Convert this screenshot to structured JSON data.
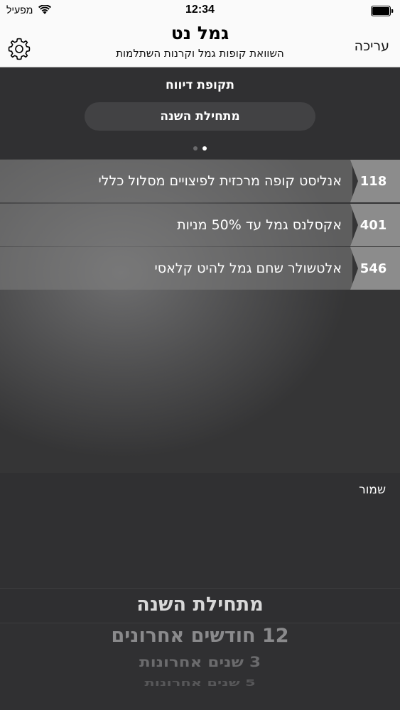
{
  "status_bar": {
    "carrier": "מפעיל",
    "time": "12:34"
  },
  "nav": {
    "title": "גמל נט",
    "subtitle": "השוואת קופות גמל וקרנות השתלמות",
    "edit_label": "עריכה"
  },
  "report": {
    "period_label": "תקופת דיווח",
    "period_value": "מתחילת השנה",
    "page_count": 2,
    "current_page": 1
  },
  "funds": [
    {
      "rank": "118",
      "name": "אנליסט קופה מרכזית לפיצויים מסלול כללי"
    },
    {
      "rank": "401",
      "name": "אקסלנס גמל עד 50% מניות"
    },
    {
      "rank": "546",
      "name": "אלטשולר שחם גמל להיט קלאסי"
    }
  ],
  "toolbar": {
    "save_label": "שמור"
  },
  "picker": {
    "selected": "מתחילת השנה",
    "options": [
      "12 חודשים אחרונים",
      "3 שנים אחרונות",
      "5 שנים אחרונות"
    ]
  },
  "colors": {
    "bar_bg": "#fafafa",
    "panel_bg": "#303032",
    "row_bg": "#808080"
  }
}
